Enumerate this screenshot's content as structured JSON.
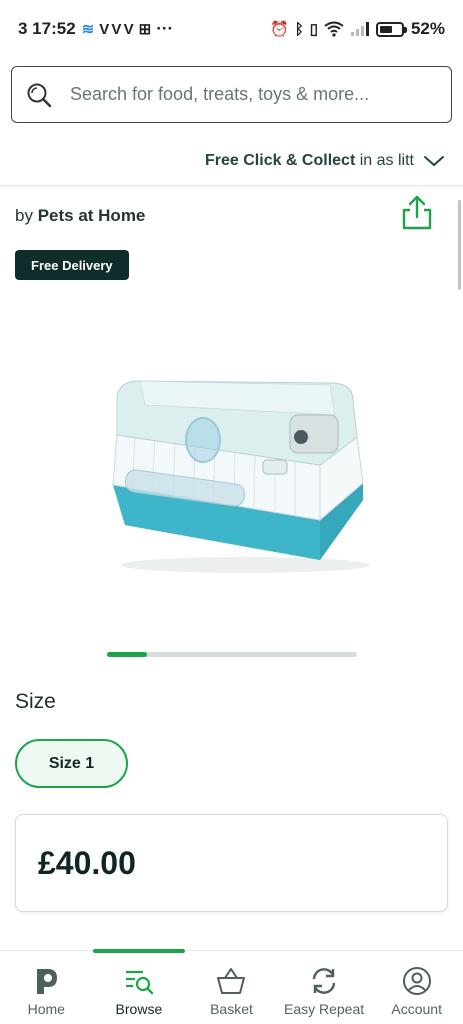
{
  "status_bar": {
    "time": "3 17:52",
    "carrier_marks": "V V V",
    "more": "···",
    "battery_percent": "52%"
  },
  "search": {
    "placeholder": "Search for food, treats, toys & more..."
  },
  "collect": {
    "bold": "Free Click & Collect",
    "rest": " in as litt"
  },
  "product": {
    "brand_prefix": "by ",
    "brand": "Pets at Home",
    "badge": "Free Delivery",
    "carousel_position": 0.16,
    "size_heading": "Size",
    "size_option": "Size 1",
    "price": "£40.00"
  },
  "colors": {
    "accent_green": "#1ea34a",
    "dark_teal": "#0e2d2b",
    "cage_base": "#4cc3d6"
  },
  "nav": {
    "items": [
      {
        "label": "Home",
        "icon": "pets-logo-icon"
      },
      {
        "label": "Browse",
        "icon": "browse-search-icon",
        "active": true
      },
      {
        "label": "Basket",
        "icon": "basket-icon"
      },
      {
        "label": "Easy Repeat",
        "icon": "repeat-icon"
      },
      {
        "label": "Account",
        "icon": "account-icon"
      }
    ]
  }
}
